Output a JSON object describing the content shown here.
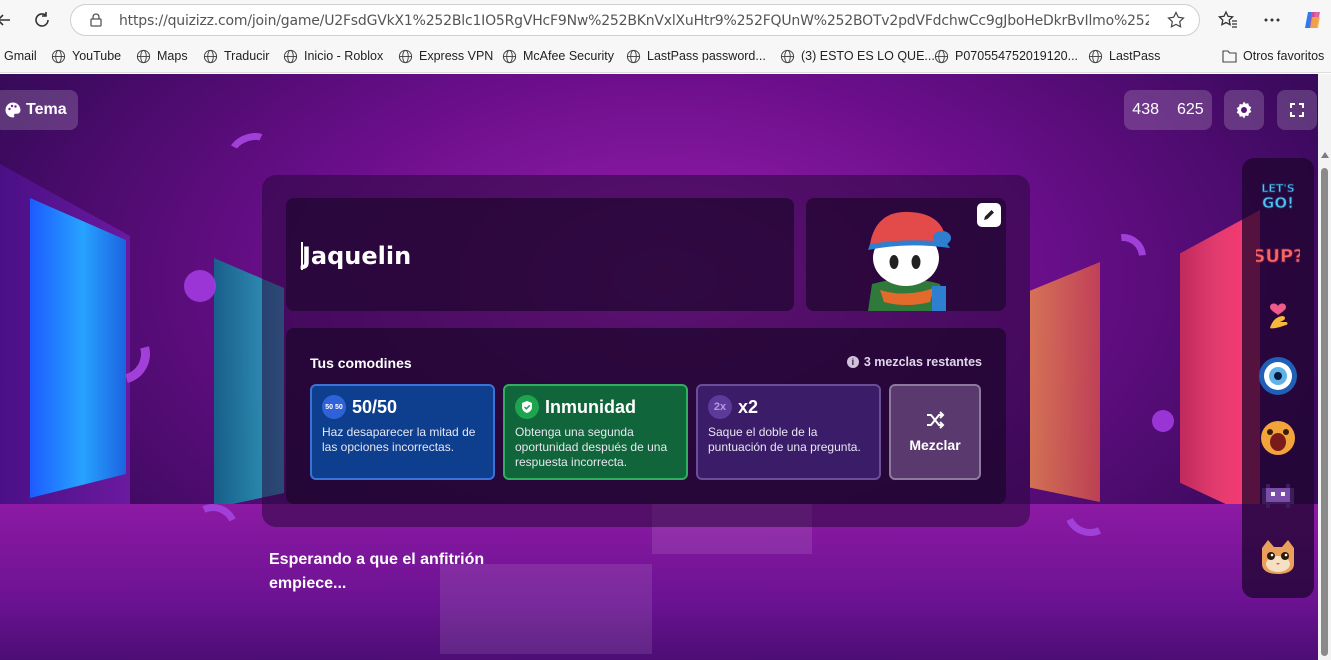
{
  "browser": {
    "url": "https://quizizz.com/join/game/U2FsdGVkX1%252Blc1IO5RgVHcF9Nw%252BKnVxlXuHtr9%252FQUnW%252BOTv2pdVFdchwCc9gJboHeDkrBvIlmo%252FoCn1Nkcr%...",
    "bookmarks": [
      {
        "label": "Gmail",
        "icon": "none"
      },
      {
        "label": "YouTube",
        "icon": "globe-icon"
      },
      {
        "label": "Maps",
        "icon": "globe-icon"
      },
      {
        "label": "Traducir",
        "icon": "globe-icon"
      },
      {
        "label": "Inicio - Roblox",
        "icon": "globe-icon"
      },
      {
        "label": "Express VPN",
        "icon": "globe-icon"
      },
      {
        "label": "McAfee Security",
        "icon": "globe-icon"
      },
      {
        "label": "LastPass password...",
        "icon": "globe-icon"
      },
      {
        "label": "(3) ESTO ES LO QUE...",
        "icon": "globe-icon"
      },
      {
        "label": "P070554752019120...",
        "icon": "globe-icon"
      },
      {
        "label": "LastPass",
        "icon": "globe-icon"
      }
    ],
    "other_favorites": "Otros favoritos"
  },
  "game": {
    "theme_label": "Tema",
    "count_a": "438",
    "count_b": "625",
    "player_name": "Jaquelin",
    "powerups_title": "Tus comodines",
    "powerups_remaining": "3 mezclas restantes",
    "powerups": [
      {
        "icon_text": "50 50",
        "name": "50/50",
        "desc": "Haz desaparecer la mitad de las opciones incorrectas."
      },
      {
        "icon_text": "✓",
        "name": "Inmunidad",
        "desc": "Obtenga una segunda oportunidad después de una respuesta incorrecta."
      },
      {
        "icon_text": "2x",
        "name": "x2",
        "desc": "Saque el doble de la puntuación de una pregunta."
      }
    ],
    "shuffle_label": "Mezclar",
    "waiting_text": "Esperando a que el anfitrión empiece...",
    "reactions": [
      "lets-go-sticker",
      "sup-sticker",
      "heart-hand-sticker",
      "eye-sticker",
      "shocked-face-sticker",
      "pixel-monster-sticker",
      "cat-face-sticker"
    ],
    "reaction_texts": {
      "lets_go": "LET'S GO!",
      "sup": "SUP?"
    }
  },
  "colors": {
    "accent_purple": "#6a0e8a",
    "card_5050": "#0e3f8f",
    "card_immunity": "#10663a",
    "card_x2": "#3b1c69"
  }
}
